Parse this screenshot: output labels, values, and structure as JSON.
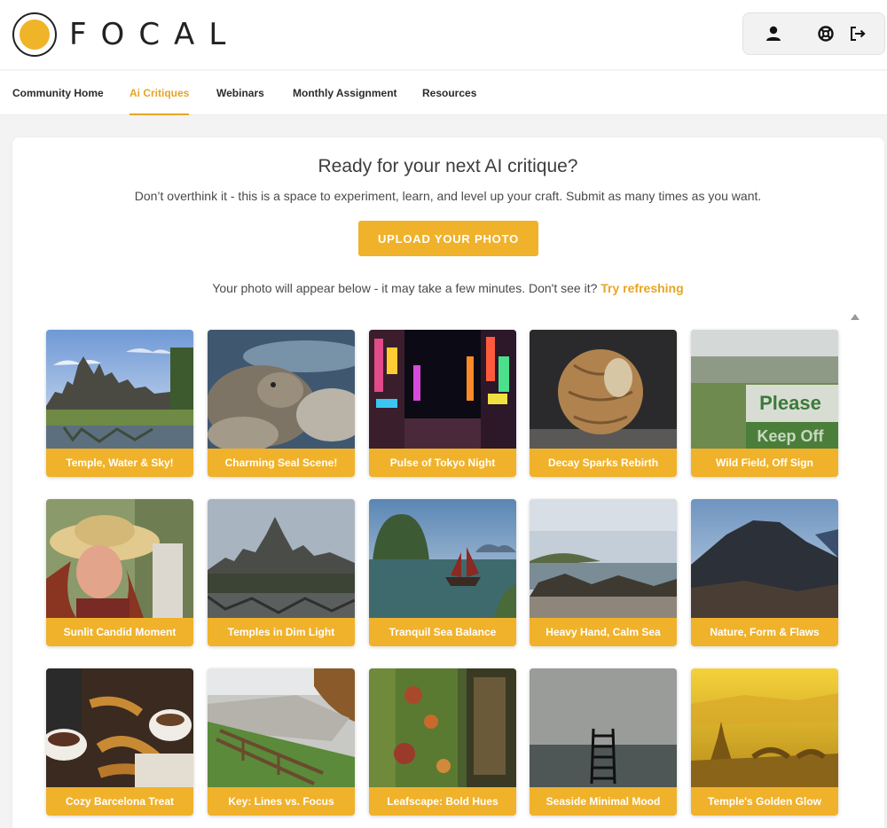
{
  "header": {
    "logo_text": "FOCAL",
    "icons": [
      "user-icon",
      "help-icon",
      "logout-icon"
    ]
  },
  "nav": {
    "items": [
      {
        "label": "Community Home",
        "active": false
      },
      {
        "label": "Ai Critiques",
        "active": true
      },
      {
        "label": "Webinars",
        "active": false
      },
      {
        "label": "Monthly Assignment",
        "active": false
      },
      {
        "label": "Resources",
        "active": false
      }
    ]
  },
  "main": {
    "title": "Ready for your next AI critique?",
    "subtitle": "Don’t overthink it - this is a space to experiment, learn, and level up your craft. Submit as many times as you want.",
    "upload_label": "UPLOAD YOUR PHOTO",
    "notice_text": "Your photo will appear below - it may take a few minutes. Don't see it?",
    "refresh_link": "Try refreshing"
  },
  "gallery": [
    {
      "label": "Temple, Water & Sky!",
      "thumb": "temple-ruins-water"
    },
    {
      "label": "Charming Seal Scene!",
      "thumb": "seal-on-rocks"
    },
    {
      "label": "Pulse of Tokyo Night",
      "thumb": "neon-street-night"
    },
    {
      "label": "Decay Sparks Rebirth",
      "thumb": "decaying-gourd"
    },
    {
      "label": "Wild Field, Off Sign",
      "thumb": "field-sign"
    },
    {
      "label": "Sunlit Candid Moment",
      "thumb": "woman-straw-hat"
    },
    {
      "label": "Temples in Dim Light",
      "thumb": "dim-temple"
    },
    {
      "label": "Tranquil Sea Balance",
      "thumb": "bay-junk-boat"
    },
    {
      "label": "Heavy Hand, Calm Sea",
      "thumb": "rocky-coast"
    },
    {
      "label": "Nature, Form & Flaws",
      "thumb": "mountain"
    },
    {
      "label": "Cozy Barcelona Treat",
      "thumb": "churros-coffee"
    },
    {
      "label": "Key: Lines vs. Focus",
      "thumb": "stone-wall-fence"
    },
    {
      "label": "Leafscape: Bold Hues",
      "thumb": "ivy-wall"
    },
    {
      "label": "Seaside Minimal Mood",
      "thumb": "ladder-sea"
    },
    {
      "label": "Temple's Golden Glow",
      "thumb": "golden-pagoda"
    }
  ],
  "colors": {
    "accent": "#f0b22b",
    "accent_text": "#e6a524"
  }
}
